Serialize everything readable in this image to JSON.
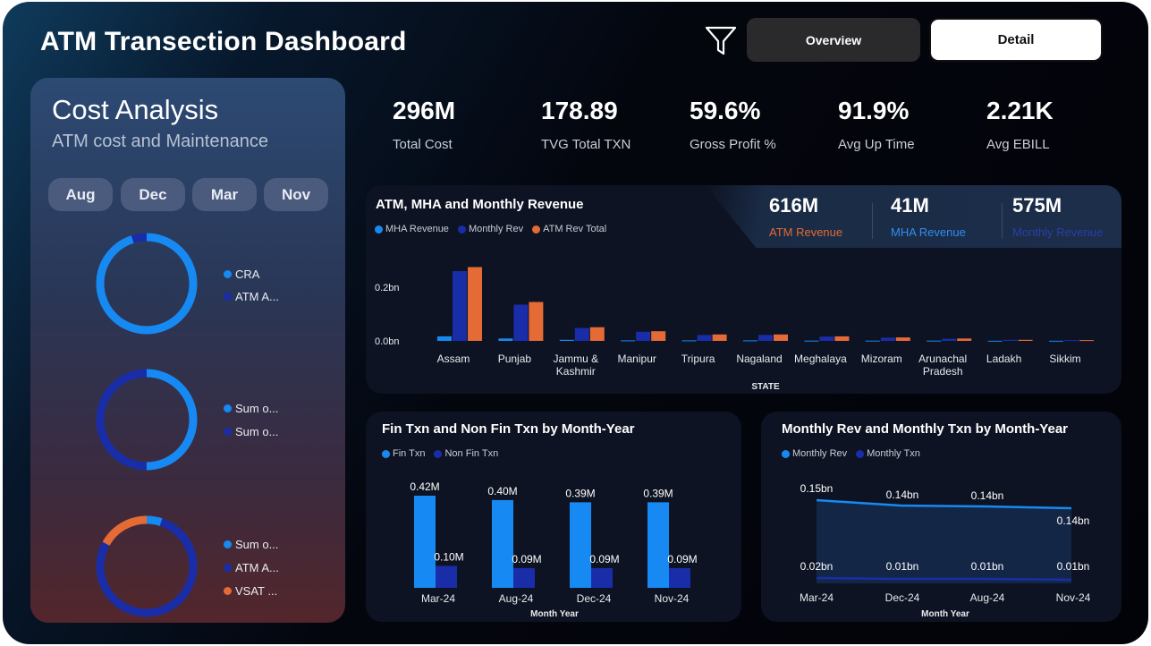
{
  "header": {
    "title": "ATM Transection Dashboard",
    "icon_filter": "filter-icon",
    "overview_label": "Overview",
    "detail_label": "Detail"
  },
  "cost_panel": {
    "title": "Cost Analysis",
    "subtitle": "ATM cost and Maintenance",
    "months": [
      "Aug",
      "Dec",
      "Mar",
      "Nov"
    ],
    "donut1": {
      "legend": [
        "CRA",
        "ATM A..."
      ],
      "colors": [
        "#168af2",
        "#1a2da8"
      ],
      "shares": [
        0.95,
        0.05
      ]
    },
    "donut2": {
      "legend": [
        "Sum o...",
        "Sum o..."
      ],
      "colors": [
        "#168af2",
        "#1a2da8"
      ],
      "shares": [
        0.5,
        0.5
      ]
    },
    "donut3": {
      "legend": [
        "Sum o...",
        "ATM A...",
        "VSAT ..."
      ],
      "colors": [
        "#168af2",
        "#1a2da8",
        "#e46a36"
      ],
      "shares": [
        0.05,
        0.78,
        0.17
      ]
    }
  },
  "kpis": [
    {
      "value": "296M",
      "label": "Total Cost"
    },
    {
      "value": "178.89",
      "label": "TVG Total TXN"
    },
    {
      "value": "59.6%",
      "label": "Gross Profit %"
    },
    {
      "value": "91.9%",
      "label": "Avg Up Time"
    },
    {
      "value": "2.21K",
      "label": "Avg EBILL"
    }
  ],
  "revenue_panel": {
    "title": "ATM, MHA and Monthly Revenue",
    "kpis": [
      {
        "value": "616M",
        "label": "ATM Revenue",
        "color": "#e46a36"
      },
      {
        "value": "41M",
        "label": "MHA Revenue",
        "color": "#2e8ef0"
      },
      {
        "value": "575M",
        "label": "Monthly Revenue",
        "color": "#2b3ea8"
      }
    ]
  },
  "fin_panel": {
    "title": "Fin Txn and Non Fin Txn by Month-Year"
  },
  "mon_panel": {
    "title": "Monthly Rev and Monthly Txn by Month-Year"
  },
  "chart_data": [
    {
      "type": "bar",
      "title": "ATM, MHA and Monthly Revenue",
      "xlabel": "STATE",
      "ylabel": "",
      "categories": [
        "Assam",
        "Punjab",
        "Jammu & Kashmir",
        "Manipur",
        "Tripura",
        "Nagaland",
        "Meghalaya",
        "Mizoram",
        "Arunachal Pradesh",
        "Ladakh",
        "Sikkim"
      ],
      "ytick_labels": [
        "0.0bn",
        "0.2bn"
      ],
      "ylim": [
        0,
        0.27
      ],
      "series": [
        {
          "name": "MHA Revenue",
          "color": "#168af2",
          "values": [
            0.017,
            0.009,
            0.004,
            0.002,
            0.002,
            0.002,
            0.001,
            0.001,
            0.001,
            0.0005,
            0.0005
          ]
        },
        {
          "name": "Monthly Rev",
          "color": "#1a2da8",
          "values": [
            0.26,
            0.135,
            0.048,
            0.034,
            0.022,
            0.022,
            0.016,
            0.012,
            0.008,
            0.004,
            0.003
          ]
        },
        {
          "name": "ATM Rev Total",
          "color": "#e46a36",
          "values": [
            0.275,
            0.145,
            0.051,
            0.036,
            0.024,
            0.024,
            0.017,
            0.013,
            0.009,
            0.004,
            0.003
          ]
        }
      ],
      "legend": "top-left"
    },
    {
      "type": "bar",
      "title": "Fin Txn and Non Fin Txn by Month-Year",
      "xlabel": "Month Year",
      "categories": [
        "Mar-24",
        "Aug-24",
        "Dec-24",
        "Nov-24"
      ],
      "ylim": [
        0,
        0.45
      ],
      "series": [
        {
          "name": "Fin Txn",
          "color": "#168af2",
          "values": [
            0.42,
            0.4,
            0.39,
            0.39
          ],
          "labels": [
            "0.42M",
            "0.40M",
            "0.39M",
            "0.39M"
          ]
        },
        {
          "name": "Non Fin Txn",
          "color": "#1a2da8",
          "values": [
            0.1,
            0.09,
            0.09,
            0.09
          ],
          "labels": [
            "0.10M",
            "0.09M",
            "0.09M",
            "0.09M"
          ]
        }
      ],
      "legend": "top-left"
    },
    {
      "type": "area",
      "title": "Monthly Rev and Monthly Txn by Month-Year",
      "xlabel": "Month Year",
      "categories": [
        "Mar-24",
        "Dec-24",
        "Aug-24",
        "Nov-24"
      ],
      "ylim": [
        0,
        0.16
      ],
      "series": [
        {
          "name": "Monthly Rev",
          "color": "#168af2",
          "values": [
            0.15,
            0.14,
            0.14,
            0.14
          ],
          "labels": [
            "0.15bn",
            "0.14bn",
            "0.14bn",
            "0.14bn"
          ]
        },
        {
          "name": "Monthly Txn",
          "color": "#1a2da8",
          "values": [
            0.02,
            0.01,
            0.01,
            0.01
          ],
          "labels": [
            "0.02bn",
            "0.01bn",
            "0.01bn",
            "0.01bn"
          ]
        }
      ],
      "legend": "top-left"
    }
  ]
}
